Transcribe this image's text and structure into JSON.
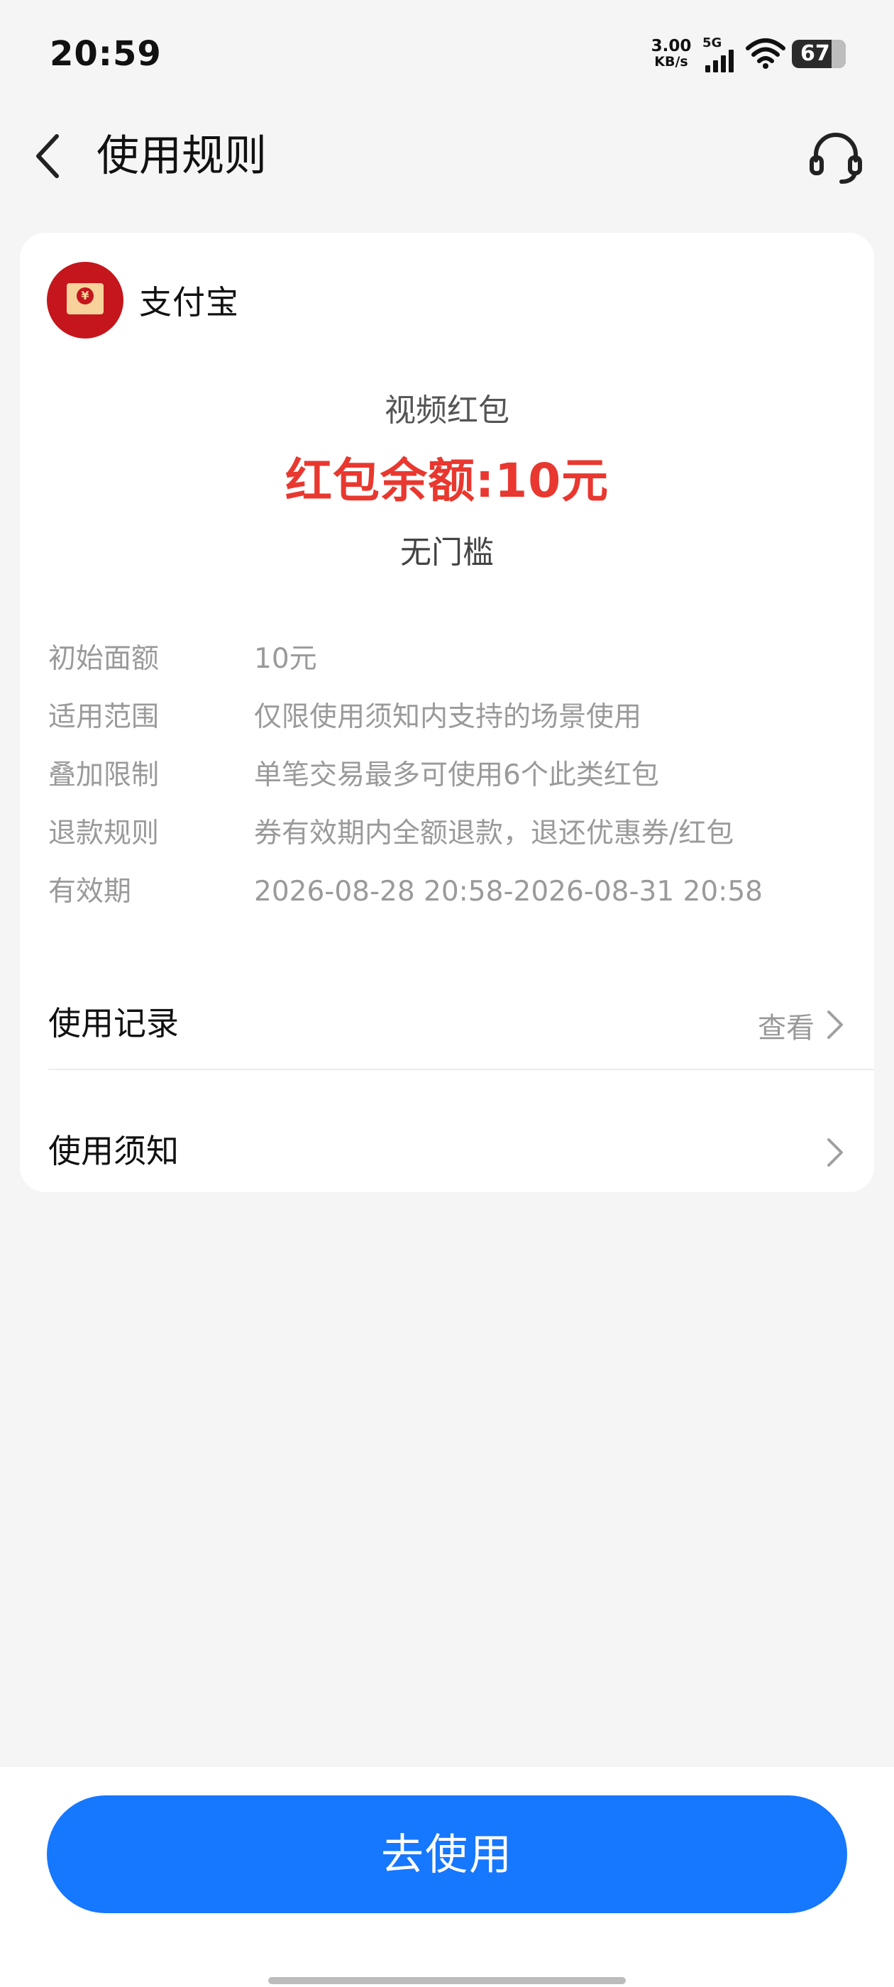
{
  "status_bar": {
    "time": "20:59",
    "net_speed_value": "3.00",
    "net_speed_unit": "KB/s",
    "network_type": "5G",
    "battery": "67"
  },
  "header": {
    "title": "使用规则"
  },
  "card": {
    "brand_name": "支付宝",
    "coupon_type": "视频红包",
    "balance": "红包余额:10元",
    "threshold": "无门槛",
    "rules": [
      {
        "label": "初始面额",
        "value": "10元"
      },
      {
        "label": "适用范围",
        "value": "仅限使用须知内支持的场景使用"
      },
      {
        "label": "叠加限制",
        "value": "单笔交易最多可使用6个此类红包"
      },
      {
        "label": "退款规则",
        "value": "券有效期内全额退款，退还优惠券/红包"
      },
      {
        "label": "有效期",
        "value": "2026-08-28 20:58-2026-08-31 20:58"
      }
    ],
    "record": {
      "title": "使用记录",
      "action": "查看"
    },
    "notice": {
      "title": "使用须知"
    }
  },
  "bottom": {
    "use_button_label": "去使用"
  },
  "colors": {
    "accent": "#1677ff",
    "balance_red": "#e8382f",
    "brand_red": "#c4161c"
  },
  "icons": {
    "back": "chevron-left-icon",
    "customer_service": "headset-icon",
    "row_arrow": "chevron-right-icon",
    "wifi": "wifi-icon",
    "signal": "signal-icon",
    "battery": "battery-icon"
  }
}
